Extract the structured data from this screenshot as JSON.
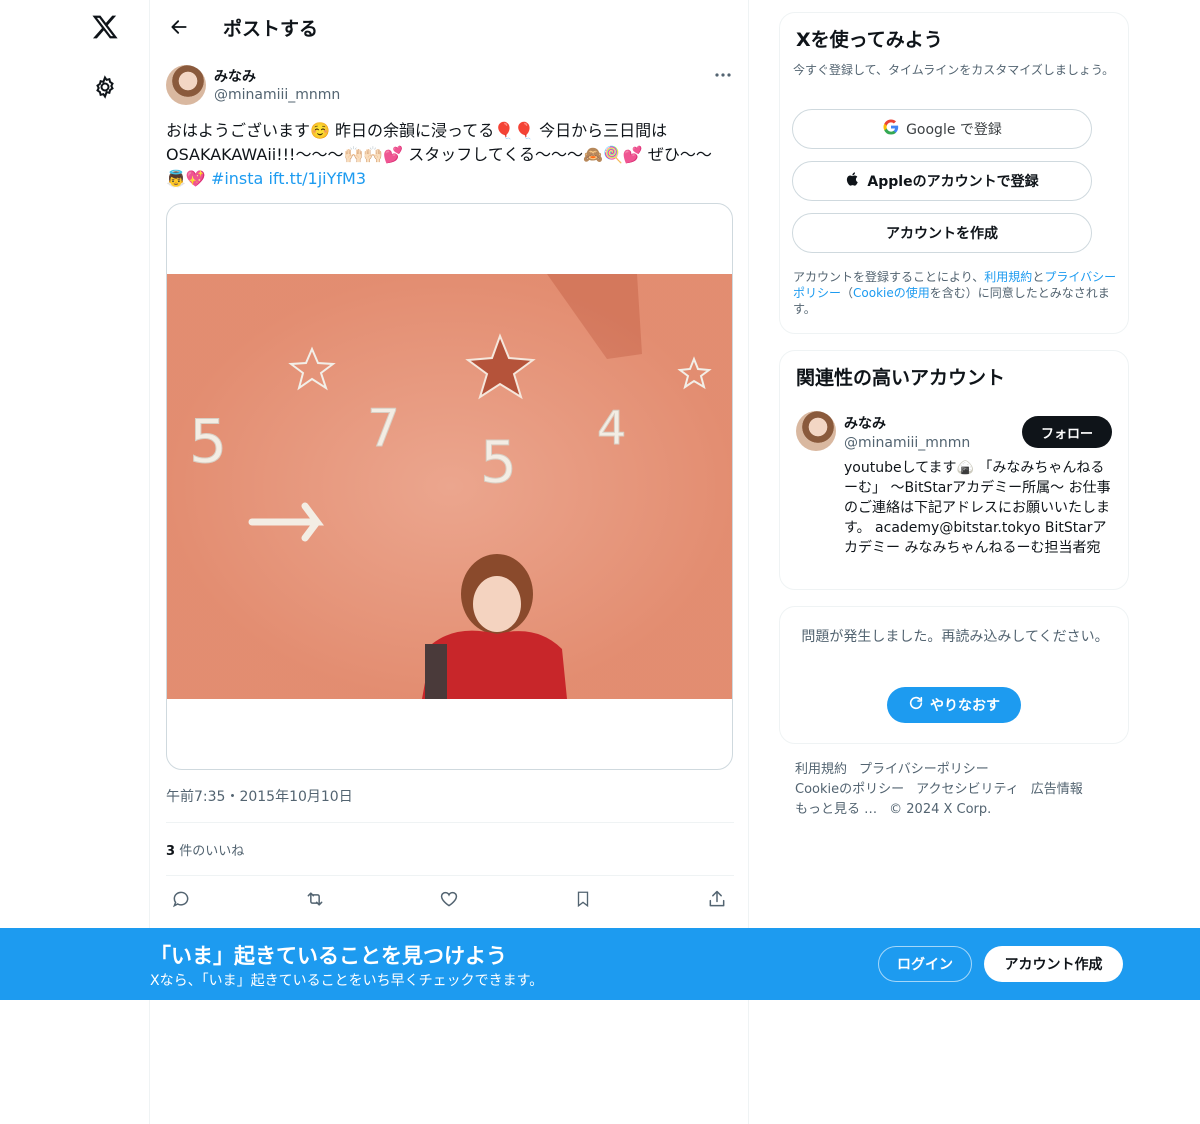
{
  "header": {
    "title": "ポストする"
  },
  "tweet": {
    "author_name": "みなみ",
    "author_handle": "@minamiii_mnmn",
    "text_part1": "おはようございます☺️ 昨日の余韻に浸ってる🎈🎈 今日から三日間は OSAKAKAWAii!!!〜〜〜🙌🏻🙌🏻💕 スタッフしてくる〜〜〜🙈🍭💕 ぜひ〜〜👼💖 ",
    "hashtag": "#insta",
    "link": "ift.tt/1jiYfM3",
    "image_numbers": [
      "5",
      "7",
      "5",
      "4"
    ],
    "timestamp": "午前7:35・2015年10月10日",
    "likes_count": "3",
    "likes_label": "件のいいね"
  },
  "signup": {
    "title": "Xを使ってみよう",
    "subtitle": "今すぐ登録して、タイムラインをカスタマイズしましょう。",
    "google_label": "Google で登録",
    "apple_label": "Appleのアカウントで登録",
    "create_label": "アカウントを作成",
    "terms_prefix": "アカウントを登録することにより、",
    "terms_link1": "利用規約",
    "terms_mid1": "と",
    "terms_link2": "プライバシーポリシー",
    "terms_mid2": "（",
    "terms_link3": "Cookieの使用",
    "terms_suffix": "を含む）に同意したとみなされます。"
  },
  "related": {
    "title": "関連性の高いアカウント",
    "name": "みなみ",
    "handle": "@minamiii_mnmn",
    "follow_label": "フォロー",
    "bio": "youtubeしてます🍙 「みなみちゃんねるーむ」 〜BitStarアカデミー所属〜 お仕事のご連絡は下記アドレスにお願いいたします。 academy@bitstar.tokyo BitStarアカデミー みなみちゃんねるーむ担当者宛"
  },
  "error": {
    "message": "問題が発生しました。再読み込みしてください。",
    "retry_label": "やりなおす"
  },
  "footer": {
    "links": [
      "利用規約",
      "プライバシーポリシー",
      "Cookieのポリシー",
      "アクセシビリティ",
      "広告情報",
      "もっと見る …",
      "© 2024 X Corp."
    ]
  },
  "bottom_bar": {
    "title": "「いま」起きていることを見つけよう",
    "subtitle": "Xなら、「いま」起きていることをいち早くチェックできます。",
    "login_label": "ログイン",
    "signup_label": "アカウント作成"
  },
  "colors": {
    "accent": "#1d9bf0",
    "text": "#0f1419",
    "muted": "#536471",
    "photo_wall": "#e8967a"
  }
}
